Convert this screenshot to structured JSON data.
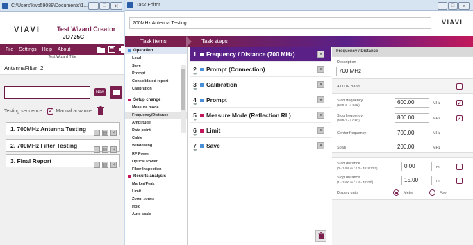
{
  "left_window": {
    "title": "C:\\Users\\kwo59088\\Documents\\1...",
    "brand": "VIAVI",
    "app_title": "Test Wizard Creator",
    "app_model": "JD725C",
    "menu": [
      "File",
      "Settings",
      "Help",
      "About"
    ],
    "subtitle": "Test Wizard Title",
    "wizard_name": "AntennaFilter_2",
    "new_label": "New",
    "seq_label": "Testing sequence",
    "manual_label": "Manual advance",
    "sequence": [
      "1. 700MHz Antenna Testing",
      "2. 700MHz Filter Testing",
      "3. Final Report"
    ]
  },
  "right_window": {
    "title": "Task Editor",
    "sequence_name": "700MHz Antenna Testing",
    "brand": "VIAVI",
    "header_items": "Task items",
    "header_steps": "Task steps",
    "task_groups": [
      {
        "label": "Operation",
        "color": "#4a90d9",
        "selected": true,
        "items": [
          "Load",
          "Save",
          "Prompt",
          "Consolidated report",
          "Calibration"
        ]
      },
      {
        "label": "Setup change",
        "color": "#c2185b",
        "selected": false,
        "items": [
          "Measure mode",
          "Frequency/Distance",
          "Amplitude",
          "Data point",
          "Cable",
          "Windowing",
          "RF Power",
          "Optical Power",
          "Fiber Inspection"
        ]
      },
      {
        "label": "Results analysis",
        "color": "#c2185b",
        "selected": false,
        "items": [
          "Marker/Peak",
          "Limit",
          "Zoom zones",
          "Hold",
          "Auto scale"
        ]
      }
    ],
    "steps": [
      {
        "num": "1",
        "label": "Frequency / Distance (700 MHz)",
        "color": "#ffffff",
        "selected": true
      },
      {
        "num": "2",
        "label": "Prompt (Connection)",
        "color": "#4a90d9",
        "selected": false
      },
      {
        "num": "3",
        "label": "Calibration",
        "color": "#4a90d9",
        "selected": false
      },
      {
        "num": "4",
        "label": "Prompt",
        "color": "#4a90d9",
        "selected": false
      },
      {
        "num": "5",
        "label": "Measure Mode (Reflection RL)",
        "color": "#c2185b",
        "selected": false
      },
      {
        "num": "6",
        "label": "Limit",
        "color": "#c2185b",
        "selected": false
      },
      {
        "num": "7",
        "label": "Save",
        "color": "#4a90d9",
        "selected": false
      }
    ],
    "detail": {
      "heading": "Frequency / Distance",
      "desc_label": "Description",
      "desc_value": "700 MHz",
      "all_dtf": "All DTF Band",
      "start_freq_label": "Start frequency",
      "start_freq_range": "(5 MHz - 4 GHz)",
      "start_freq": "600.00",
      "stop_freq_label": "Stop frequency",
      "stop_freq_range": "(5 MHz - 4 GHz)",
      "stop_freq": "800.00",
      "center_label": "Center frequency",
      "center_freq": "700.00",
      "span_label": "Span",
      "span": "200.00",
      "unit_mhz": "MHz",
      "start_dist_label": "Start distance",
      "start_dist_range": "(0 - 1499 m / 0.0 - 4918.72 ft)",
      "start_dist": "0.00",
      "stop_dist_label": "Stop distance",
      "stop_dist_range": "(1 - 1500 m / 1.4 - 4920 ft)",
      "stop_dist": "15.00",
      "unit_m": "m",
      "display_units_label": "Display units",
      "meter": "Meter",
      "foot": "Foot"
    }
  }
}
